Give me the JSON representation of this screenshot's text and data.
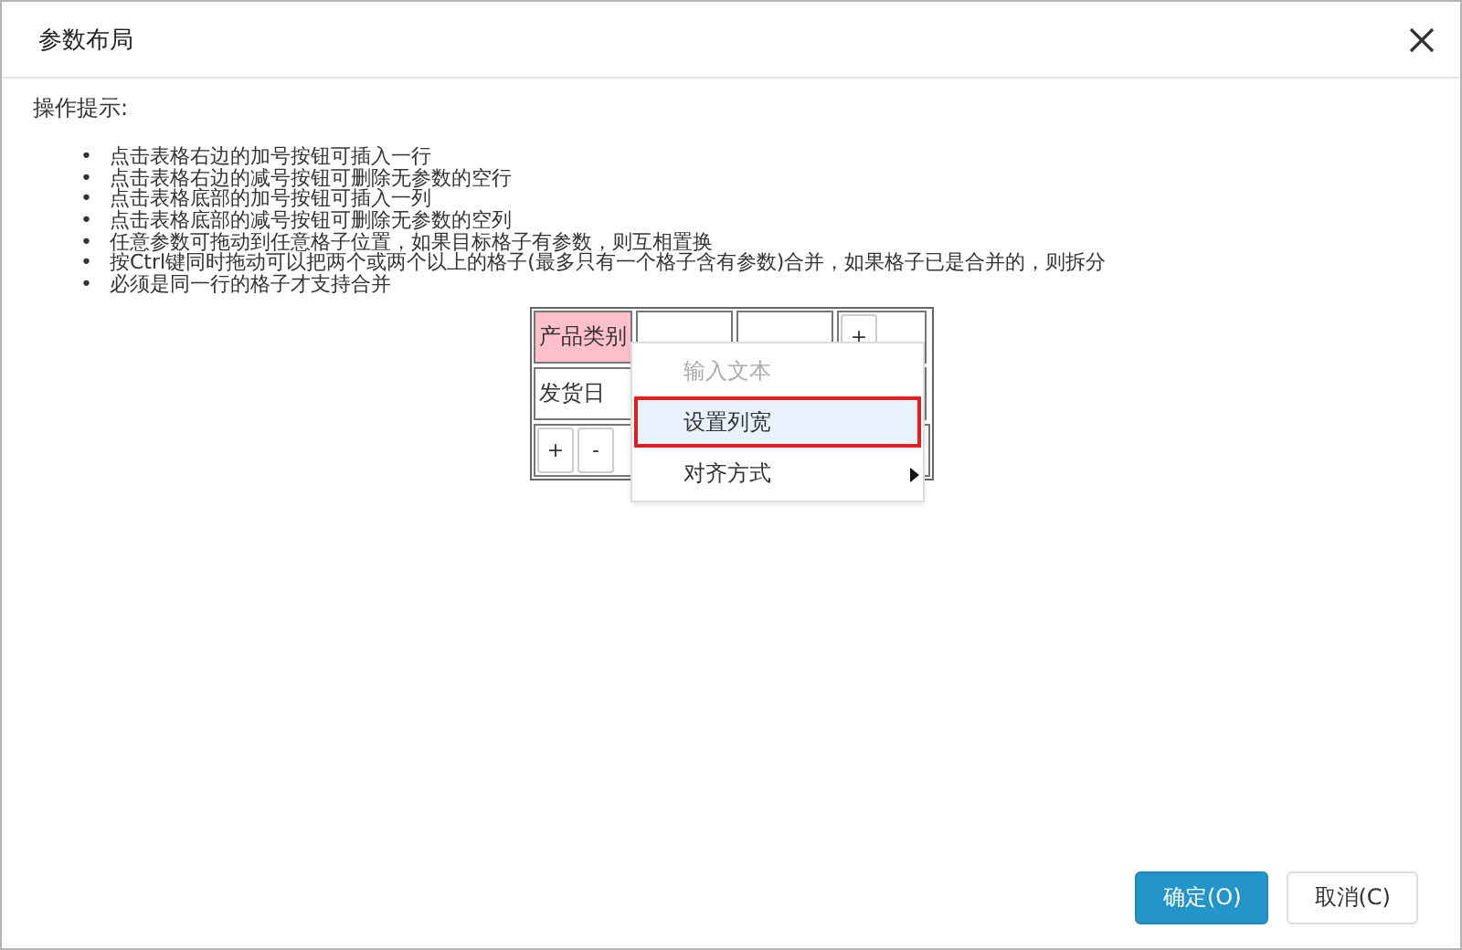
{
  "dialog": {
    "title": "参数布局"
  },
  "hint_title": "操作提示:",
  "hints": [
    {
      "bullet": "•",
      "text": "点击表格右边的加号按钮可插入一行"
    },
    {
      "bullet": "•",
      "text": "点击表格右边的减号按钮可删除无参数的空行"
    },
    {
      "bullet": "•",
      "text": "点击表格底部的加号按钮可插入一列"
    },
    {
      "bullet": "•",
      "text": "点击表格底部的减号按钮可删除无参数的空列"
    },
    {
      "bullet": "•",
      "text": "任意参数可拖动到任意格子位置，如果目标格子有参数，则互相置换"
    },
    {
      "bullet": "•",
      "text": "按Ctrl键同时拖动可以把两个或两个以上的格子(最多只有一个格子含有参数)合并，如果格子已是合并的，则拆分"
    },
    {
      "bullet": "•",
      "text": "必须是同一行的格子才支持合并"
    }
  ],
  "grid": {
    "rows": [
      {
        "cells": [
          {
            "kind": "param",
            "text": "产品类别",
            "selected": true
          },
          {
            "kind": "empty"
          },
          {
            "kind": "empty"
          }
        ],
        "row_buttons": [
          "+"
        ]
      },
      {
        "cells": [
          {
            "kind": "param",
            "text": "发货日",
            "selected": false
          }
        ]
      }
    ],
    "column_buttons": [
      "+",
      "-"
    ]
  },
  "context_menu": [
    {
      "label": "输入文本",
      "disabled": true,
      "selected": false,
      "submenu": false
    },
    {
      "label": "设置列宽",
      "disabled": false,
      "selected": true,
      "submenu": false
    },
    {
      "label": "对齐方式",
      "disabled": false,
      "selected": false,
      "submenu": true
    }
  ],
  "buttons": [
    {
      "label": "确定(O)",
      "kind": "primary"
    },
    {
      "label": "取消(C)",
      "kind": "secondary"
    }
  ]
}
